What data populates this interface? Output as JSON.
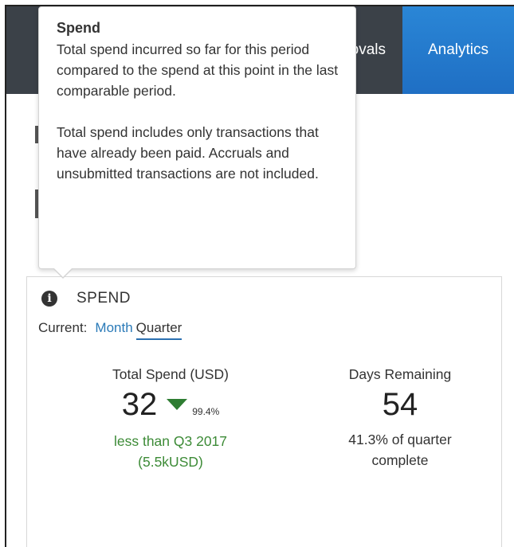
{
  "nav": {
    "partial_tab": "Approvals",
    "active_tab": "Analytics"
  },
  "tooltip": {
    "title": "Spend",
    "paragraph1": "Total spend incurred so far for this period compared to the spend at this point in the last comparable period.",
    "paragraph2": "Total spend includes only transactions that have already been paid. Accruals and unsubmitted transactions are not included."
  },
  "card": {
    "info_icon": "info-circle-icon",
    "title": "SPEND",
    "period": {
      "label": "Current:",
      "month": "Month",
      "quarter": "Quarter",
      "selected": "Quarter"
    },
    "total_spend": {
      "label": "Total Spend (USD)",
      "value": "32",
      "trend_icon": "triangle-down-icon",
      "change_pct": "99.4%",
      "compare_line1": "less than Q3 2017",
      "compare_line2": "(5.5kUSD)"
    },
    "days_remaining": {
      "label": "Days Remaining",
      "value": "54",
      "progress_line1": "41.3% of quarter",
      "progress_line2": "complete"
    }
  },
  "colors": {
    "nav_bg": "#3b4148",
    "active_tab": "#2a86d6",
    "link_blue": "#2a7ab8",
    "positive_green": "#3d8b37",
    "arrow_green": "#2e7d32"
  }
}
